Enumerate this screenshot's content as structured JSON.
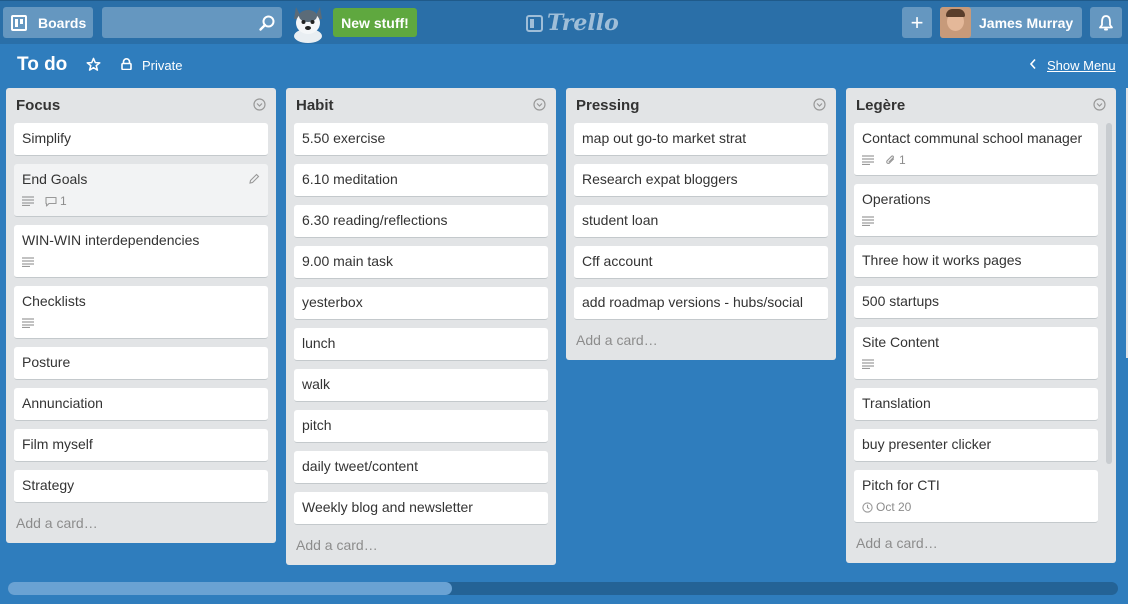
{
  "header": {
    "boards_label": "Boards",
    "search": {
      "value": "",
      "placeholder": ""
    },
    "new_stuff_label": "New stuff!",
    "logo_text": "Trello",
    "add_label": "+",
    "user_name": "James Murray"
  },
  "board": {
    "title": "To do",
    "privacy": "Private",
    "show_menu_label": "Show Menu"
  },
  "lists": [
    {
      "title": "Focus",
      "cards": [
        {
          "title": "Simplify"
        },
        {
          "title": "End Goals",
          "description": true,
          "comments": "1",
          "hover": true
        },
        {
          "title": "WIN-WIN interdependencies",
          "description": true
        },
        {
          "title": "Checklists",
          "description": true
        },
        {
          "title": "Posture"
        },
        {
          "title": "Annunciation"
        },
        {
          "title": "Film myself"
        },
        {
          "title": "Strategy"
        }
      ],
      "add_card_label": "Add a card…"
    },
    {
      "title": "Habit",
      "cards": [
        {
          "title": "5.50 exercise"
        },
        {
          "title": "6.10 meditation"
        },
        {
          "title": "6.30 reading/reflections"
        },
        {
          "title": "9.00 main task"
        },
        {
          "title": "yesterbox"
        },
        {
          "title": "lunch"
        },
        {
          "title": "walk"
        },
        {
          "title": "pitch"
        },
        {
          "title": "daily tweet/content"
        },
        {
          "title": "Weekly blog and newsletter"
        }
      ],
      "add_card_label": "Add a card…"
    },
    {
      "title": "Pressing",
      "cards": [
        {
          "title": "map out go-to market strat"
        },
        {
          "title": "Research expat bloggers"
        },
        {
          "title": "student loan"
        },
        {
          "title": "Cff account"
        },
        {
          "title": "add roadmap versions - hubs/social"
        }
      ],
      "add_card_label": "Add a card…"
    },
    {
      "title": "Legère",
      "cards": [
        {
          "title": "Contact communal school manager",
          "description": true,
          "attachments": "1"
        },
        {
          "title": "Operations",
          "description": true
        },
        {
          "title": "Three how it works pages"
        },
        {
          "title": "500 startups"
        },
        {
          "title": "Site Content",
          "description": true
        },
        {
          "title": "Translation"
        },
        {
          "title": "buy presenter clicker"
        },
        {
          "title": "Pitch for CTI",
          "due": "Oct 20"
        }
      ],
      "add_card_label": "Add a card…"
    }
  ],
  "colors": {
    "board_background": "#2f7dbd",
    "header_background": "#2a6fa8",
    "new_stuff_green": "#5fa83f",
    "list_background": "#e2e4e6"
  },
  "horizontal_scroll": {
    "position_fraction": 0.0,
    "visible_fraction": 0.4
  }
}
